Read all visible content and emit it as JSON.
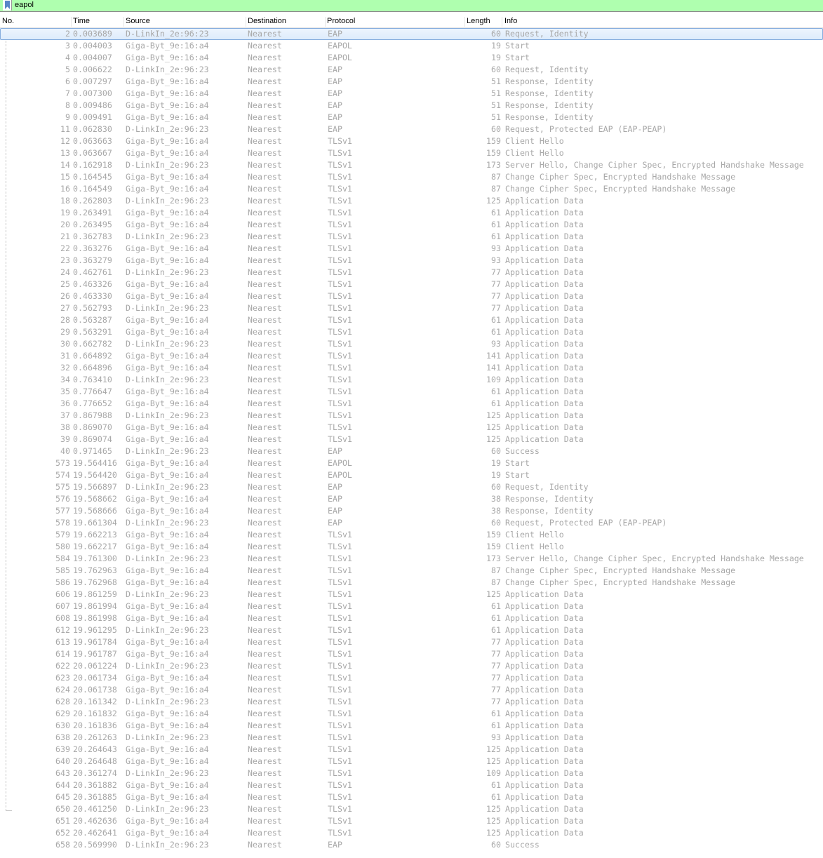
{
  "filter": {
    "value": "eapol"
  },
  "columns": {
    "no": "No.",
    "time": "Time",
    "source": "Source",
    "destination": "Destination",
    "protocol": "Protocol",
    "length": "Length",
    "info": "Info"
  },
  "packets": [
    [
      "2",
      "0.003689",
      "D-LinkIn_2e:96:23",
      "Nearest",
      "EAP",
      "60",
      "Request, Identity"
    ],
    [
      "3",
      "0.004003",
      "Giga-Byt_9e:16:a4",
      "Nearest",
      "EAPOL",
      "19",
      "Start"
    ],
    [
      "4",
      "0.004007",
      "Giga-Byt_9e:16:a4",
      "Nearest",
      "EAPOL",
      "19",
      "Start"
    ],
    [
      "5",
      "0.006622",
      "D-LinkIn_2e:96:23",
      "Nearest",
      "EAP",
      "60",
      "Request, Identity"
    ],
    [
      "6",
      "0.007297",
      "Giga-Byt_9e:16:a4",
      "Nearest",
      "EAP",
      "51",
      "Response, Identity"
    ],
    [
      "7",
      "0.007300",
      "Giga-Byt_9e:16:a4",
      "Nearest",
      "EAP",
      "51",
      "Response, Identity"
    ],
    [
      "8",
      "0.009486",
      "Giga-Byt_9e:16:a4",
      "Nearest",
      "EAP",
      "51",
      "Response, Identity"
    ],
    [
      "9",
      "0.009491",
      "Giga-Byt_9e:16:a4",
      "Nearest",
      "EAP",
      "51",
      "Response, Identity"
    ],
    [
      "11",
      "0.062830",
      "D-LinkIn_2e:96:23",
      "Nearest",
      "EAP",
      "60",
      "Request, Protected EAP (EAP-PEAP)"
    ],
    [
      "12",
      "0.063663",
      "Giga-Byt_9e:16:a4",
      "Nearest",
      "TLSv1",
      "159",
      "Client Hello"
    ],
    [
      "13",
      "0.063667",
      "Giga-Byt_9e:16:a4",
      "Nearest",
      "TLSv1",
      "159",
      "Client Hello"
    ],
    [
      "14",
      "0.162918",
      "D-LinkIn_2e:96:23",
      "Nearest",
      "TLSv1",
      "173",
      "Server Hello, Change Cipher Spec, Encrypted Handshake Message"
    ],
    [
      "15",
      "0.164545",
      "Giga-Byt_9e:16:a4",
      "Nearest",
      "TLSv1",
      "87",
      "Change Cipher Spec, Encrypted Handshake Message"
    ],
    [
      "16",
      "0.164549",
      "Giga-Byt_9e:16:a4",
      "Nearest",
      "TLSv1",
      "87",
      "Change Cipher Spec, Encrypted Handshake Message"
    ],
    [
      "18",
      "0.262803",
      "D-LinkIn_2e:96:23",
      "Nearest",
      "TLSv1",
      "125",
      "Application Data"
    ],
    [
      "19",
      "0.263491",
      "Giga-Byt_9e:16:a4",
      "Nearest",
      "TLSv1",
      "61",
      "Application Data"
    ],
    [
      "20",
      "0.263495",
      "Giga-Byt_9e:16:a4",
      "Nearest",
      "TLSv1",
      "61",
      "Application Data"
    ],
    [
      "21",
      "0.362783",
      "D-LinkIn_2e:96:23",
      "Nearest",
      "TLSv1",
      "61",
      "Application Data"
    ],
    [
      "22",
      "0.363276",
      "Giga-Byt_9e:16:a4",
      "Nearest",
      "TLSv1",
      "93",
      "Application Data"
    ],
    [
      "23",
      "0.363279",
      "Giga-Byt_9e:16:a4",
      "Nearest",
      "TLSv1",
      "93",
      "Application Data"
    ],
    [
      "24",
      "0.462761",
      "D-LinkIn_2e:96:23",
      "Nearest",
      "TLSv1",
      "77",
      "Application Data"
    ],
    [
      "25",
      "0.463326",
      "Giga-Byt_9e:16:a4",
      "Nearest",
      "TLSv1",
      "77",
      "Application Data"
    ],
    [
      "26",
      "0.463330",
      "Giga-Byt_9e:16:a4",
      "Nearest",
      "TLSv1",
      "77",
      "Application Data"
    ],
    [
      "27",
      "0.562793",
      "D-LinkIn_2e:96:23",
      "Nearest",
      "TLSv1",
      "77",
      "Application Data"
    ],
    [
      "28",
      "0.563287",
      "Giga-Byt_9e:16:a4",
      "Nearest",
      "TLSv1",
      "61",
      "Application Data"
    ],
    [
      "29",
      "0.563291",
      "Giga-Byt_9e:16:a4",
      "Nearest",
      "TLSv1",
      "61",
      "Application Data"
    ],
    [
      "30",
      "0.662782",
      "D-LinkIn_2e:96:23",
      "Nearest",
      "TLSv1",
      "93",
      "Application Data"
    ],
    [
      "31",
      "0.664892",
      "Giga-Byt_9e:16:a4",
      "Nearest",
      "TLSv1",
      "141",
      "Application Data"
    ],
    [
      "32",
      "0.664896",
      "Giga-Byt_9e:16:a4",
      "Nearest",
      "TLSv1",
      "141",
      "Application Data"
    ],
    [
      "34",
      "0.763410",
      "D-LinkIn_2e:96:23",
      "Nearest",
      "TLSv1",
      "109",
      "Application Data"
    ],
    [
      "35",
      "0.776647",
      "Giga-Byt_9e:16:a4",
      "Nearest",
      "TLSv1",
      "61",
      "Application Data"
    ],
    [
      "36",
      "0.776652",
      "Giga-Byt_9e:16:a4",
      "Nearest",
      "TLSv1",
      "61",
      "Application Data"
    ],
    [
      "37",
      "0.867988",
      "D-LinkIn_2e:96:23",
      "Nearest",
      "TLSv1",
      "125",
      "Application Data"
    ],
    [
      "38",
      "0.869070",
      "Giga-Byt_9e:16:a4",
      "Nearest",
      "TLSv1",
      "125",
      "Application Data"
    ],
    [
      "39",
      "0.869074",
      "Giga-Byt_9e:16:a4",
      "Nearest",
      "TLSv1",
      "125",
      "Application Data"
    ],
    [
      "40",
      "0.971465",
      "D-LinkIn_2e:96:23",
      "Nearest",
      "EAP",
      "60",
      "Success"
    ],
    [
      "573",
      "19.564416",
      "Giga-Byt_9e:16:a4",
      "Nearest",
      "EAPOL",
      "19",
      "Start"
    ],
    [
      "574",
      "19.564420",
      "Giga-Byt_9e:16:a4",
      "Nearest",
      "EAPOL",
      "19",
      "Start"
    ],
    [
      "575",
      "19.566897",
      "D-LinkIn_2e:96:23",
      "Nearest",
      "EAP",
      "60",
      "Request, Identity"
    ],
    [
      "576",
      "19.568662",
      "Giga-Byt_9e:16:a4",
      "Nearest",
      "EAP",
      "38",
      "Response, Identity"
    ],
    [
      "577",
      "19.568666",
      "Giga-Byt_9e:16:a4",
      "Nearest",
      "EAP",
      "38",
      "Response, Identity"
    ],
    [
      "578",
      "19.661304",
      "D-LinkIn_2e:96:23",
      "Nearest",
      "EAP",
      "60",
      "Request, Protected EAP (EAP-PEAP)"
    ],
    [
      "579",
      "19.662213",
      "Giga-Byt_9e:16:a4",
      "Nearest",
      "TLSv1",
      "159",
      "Client Hello"
    ],
    [
      "580",
      "19.662217",
      "Giga-Byt_9e:16:a4",
      "Nearest",
      "TLSv1",
      "159",
      "Client Hello"
    ],
    [
      "584",
      "19.761300",
      "D-LinkIn_2e:96:23",
      "Nearest",
      "TLSv1",
      "173",
      "Server Hello, Change Cipher Spec, Encrypted Handshake Message"
    ],
    [
      "585",
      "19.762963",
      "Giga-Byt_9e:16:a4",
      "Nearest",
      "TLSv1",
      "87",
      "Change Cipher Spec, Encrypted Handshake Message"
    ],
    [
      "586",
      "19.762968",
      "Giga-Byt_9e:16:a4",
      "Nearest",
      "TLSv1",
      "87",
      "Change Cipher Spec, Encrypted Handshake Message"
    ],
    [
      "606",
      "19.861259",
      "D-LinkIn_2e:96:23",
      "Nearest",
      "TLSv1",
      "125",
      "Application Data"
    ],
    [
      "607",
      "19.861994",
      "Giga-Byt_9e:16:a4",
      "Nearest",
      "TLSv1",
      "61",
      "Application Data"
    ],
    [
      "608",
      "19.861998",
      "Giga-Byt_9e:16:a4",
      "Nearest",
      "TLSv1",
      "61",
      "Application Data"
    ],
    [
      "612",
      "19.961295",
      "D-LinkIn_2e:96:23",
      "Nearest",
      "TLSv1",
      "61",
      "Application Data"
    ],
    [
      "613",
      "19.961784",
      "Giga-Byt_9e:16:a4",
      "Nearest",
      "TLSv1",
      "77",
      "Application Data"
    ],
    [
      "614",
      "19.961787",
      "Giga-Byt_9e:16:a4",
      "Nearest",
      "TLSv1",
      "77",
      "Application Data"
    ],
    [
      "622",
      "20.061224",
      "D-LinkIn_2e:96:23",
      "Nearest",
      "TLSv1",
      "77",
      "Application Data"
    ],
    [
      "623",
      "20.061734",
      "Giga-Byt_9e:16:a4",
      "Nearest",
      "TLSv1",
      "77",
      "Application Data"
    ],
    [
      "624",
      "20.061738",
      "Giga-Byt_9e:16:a4",
      "Nearest",
      "TLSv1",
      "77",
      "Application Data"
    ],
    [
      "628",
      "20.161342",
      "D-LinkIn_2e:96:23",
      "Nearest",
      "TLSv1",
      "77",
      "Application Data"
    ],
    [
      "629",
      "20.161832",
      "Giga-Byt_9e:16:a4",
      "Nearest",
      "TLSv1",
      "61",
      "Application Data"
    ],
    [
      "630",
      "20.161836",
      "Giga-Byt_9e:16:a4",
      "Nearest",
      "TLSv1",
      "61",
      "Application Data"
    ],
    [
      "638",
      "20.261263",
      "D-LinkIn_2e:96:23",
      "Nearest",
      "TLSv1",
      "93",
      "Application Data"
    ],
    [
      "639",
      "20.264643",
      "Giga-Byt_9e:16:a4",
      "Nearest",
      "TLSv1",
      "125",
      "Application Data"
    ],
    [
      "640",
      "20.264648",
      "Giga-Byt_9e:16:a4",
      "Nearest",
      "TLSv1",
      "125",
      "Application Data"
    ],
    [
      "643",
      "20.361274",
      "D-LinkIn_2e:96:23",
      "Nearest",
      "TLSv1",
      "109",
      "Application Data"
    ],
    [
      "644",
      "20.361882",
      "Giga-Byt_9e:16:a4",
      "Nearest",
      "TLSv1",
      "61",
      "Application Data"
    ],
    [
      "645",
      "20.361885",
      "Giga-Byt_9e:16:a4",
      "Nearest",
      "TLSv1",
      "61",
      "Application Data"
    ],
    [
      "650",
      "20.461250",
      "D-LinkIn_2e:96:23",
      "Nearest",
      "TLSv1",
      "125",
      "Application Data"
    ],
    [
      "651",
      "20.462636",
      "Giga-Byt_9e:16:a4",
      "Nearest",
      "TLSv1",
      "125",
      "Application Data"
    ],
    [
      "652",
      "20.462641",
      "Giga-Byt_9e:16:a4",
      "Nearest",
      "TLSv1",
      "125",
      "Application Data"
    ],
    [
      "658",
      "20.569990",
      "D-LinkIn_2e:96:23",
      "Nearest",
      "EAP",
      "60",
      "Success"
    ]
  ],
  "selected_index": 0,
  "colors": {
    "filter_valid": "#afffaf",
    "row_text": "#a8a8a8",
    "selection": "#dcebfc"
  }
}
